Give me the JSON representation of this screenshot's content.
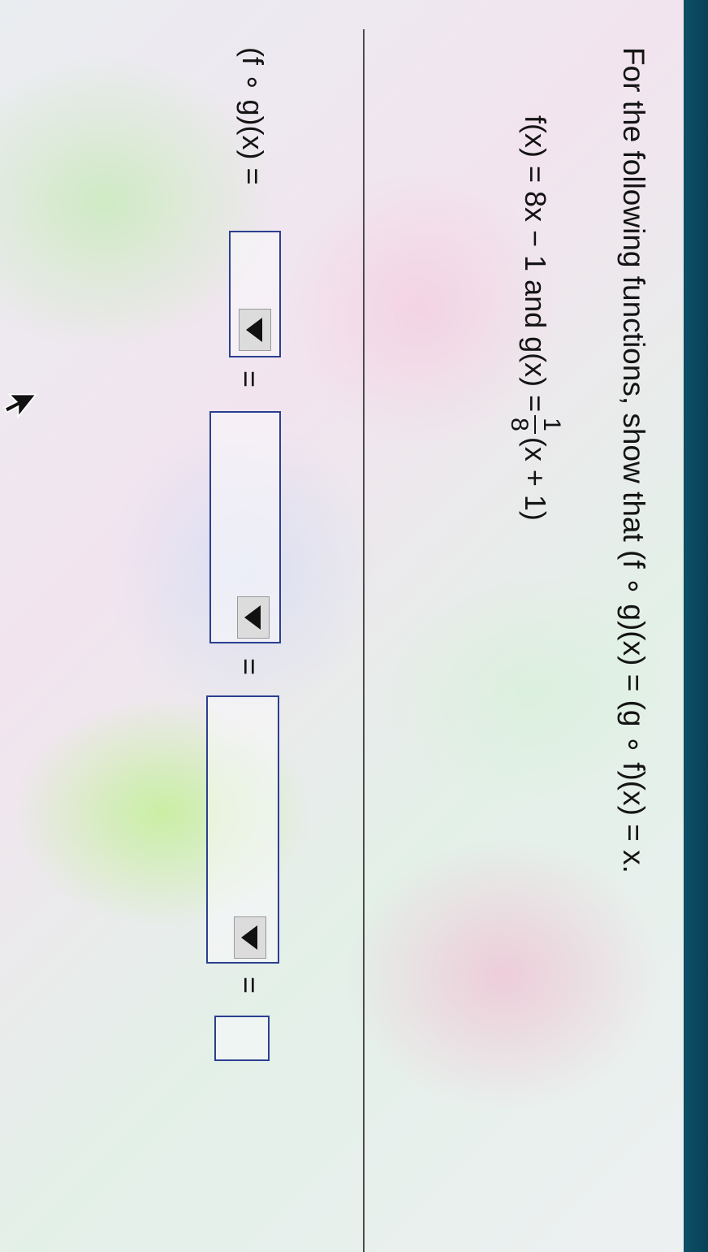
{
  "problem": {
    "prompt": "For the following functions, show that (f ∘ g)(x) = (g ∘ f)(x) = x.",
    "given_lead": "f(x) = 8x − 1 and g(x) =",
    "given_frac_num": "1",
    "given_frac_den": "8",
    "given_tail": "(x + 1)"
  },
  "work": {
    "row_label": "(f ∘ g)(x) =",
    "equals_sign": "="
  }
}
